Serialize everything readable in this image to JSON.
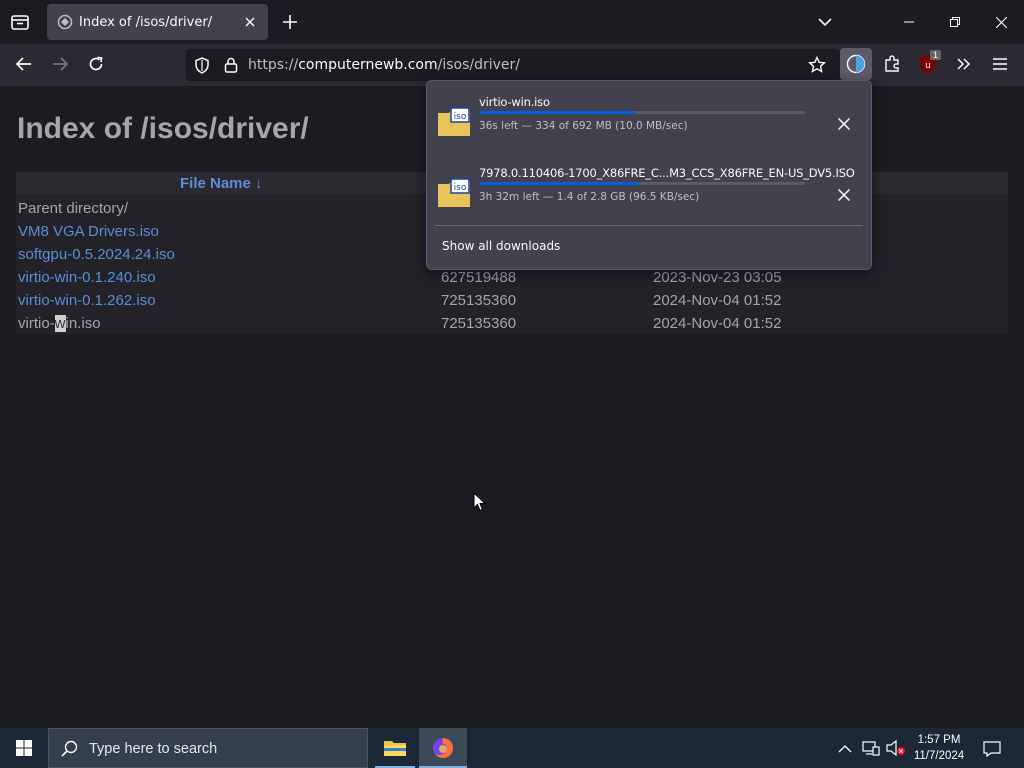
{
  "tab": {
    "title": "Index of /isos/driver/"
  },
  "urlbar": {
    "scheme": "https://",
    "host": "computernewb.com",
    "path": "/isos/driver/"
  },
  "toolbar": {
    "ublock_badge": "1"
  },
  "page": {
    "title": "Index of /isos/driver/",
    "columns": [
      "File Name ↓"
    ],
    "rows": [
      {
        "name": "Parent directory/",
        "size": "",
        "date": "",
        "type": "parent"
      },
      {
        "name": "VM8 VGA Drivers.iso",
        "size": "",
        "date": "",
        "type": "link"
      },
      {
        "name": "softgpu-0.5.2024.24.iso",
        "size": "",
        "date": "",
        "type": "link"
      },
      {
        "name": "virtio-win-0.1.240.iso",
        "size": "627519488",
        "date": "2023-Nov-23 03:05",
        "type": "link"
      },
      {
        "name": "virtio-win-0.1.262.iso",
        "size": "725135360",
        "date": "2024-Nov-04 01:52",
        "type": "link"
      },
      {
        "name_prefix": "virtio-",
        "name_highlight": "w",
        "name_suffix": "in.iso",
        "size": "725135360",
        "date": "2024-Nov-04 01:52",
        "type": "plain"
      }
    ]
  },
  "downloads": {
    "items": [
      {
        "name": "virtio-win.iso",
        "status": "36s left — 334 of 692 MB (10.0 MB/sec)",
        "progress": 0.48
      },
      {
        "name": "7978.0.110406-1700_X86FRE_C...M3_CCS_X86FRE_EN-US_DV5.ISO",
        "status": "3h 32m left — 1.4 of 2.8 GB (96.5 KB/sec)",
        "progress": 0.49
      }
    ],
    "show_all": "Show all downloads",
    "icon_label": "iso"
  },
  "taskbar": {
    "search_placeholder": "Type here to search",
    "time": "1:57 PM",
    "date": "11/7/2024"
  },
  "colors": {
    "accent": "#0060df",
    "link": "#5a8fd6",
    "taskbar": "#1b2836"
  }
}
